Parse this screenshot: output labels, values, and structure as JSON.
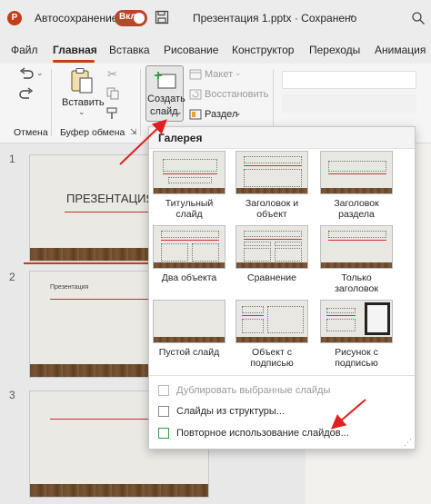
{
  "titlebar": {
    "autosave_label": "Автосохранение",
    "toggle_state": "Вкл",
    "doc_title": "Презентация 1.pptx  ·  Сохранено",
    "app_logo": "P",
    "save_icon": "save-icon",
    "search_icon": "search-icon"
  },
  "tabs": [
    "Файл",
    "Главная",
    "Вставка",
    "Рисование",
    "Конструктор",
    "Переходы",
    "Анимация"
  ],
  "ribbon": {
    "undo_group": "Отмена",
    "clipboard_group": "Буфер обмена",
    "paste_label": "Вставить",
    "new_slide_label_1": "Создать",
    "new_slide_label_2": "слайд",
    "layout_label": "Макет",
    "reset_label": "Восстановить",
    "section_label": "Раздел"
  },
  "slides": {
    "n1": "1",
    "n2": "2",
    "n3": "3",
    "slide1_title": "ПРЕЗЕНТАЦИЯ",
    "slide2_title": "Презентация"
  },
  "gallery": {
    "header": "Галерея",
    "layouts": [
      "Титульный слайд",
      "Заголовок и объект",
      "Заголовок раздела",
      "Два объекта",
      "Сравнение",
      "Только заголовок",
      "Пустой слайд",
      "Объект с подписью",
      "Рисунок с подписью"
    ],
    "menu": {
      "duplicate": "Дублировать выбранные слайды",
      "from_outline": "Слайды из структуры...",
      "reuse": "Повторное использование слайдов..."
    }
  },
  "colors": {
    "accent": "#c43e1c",
    "arrow": "#e02020",
    "toggle": "#b7472a"
  }
}
